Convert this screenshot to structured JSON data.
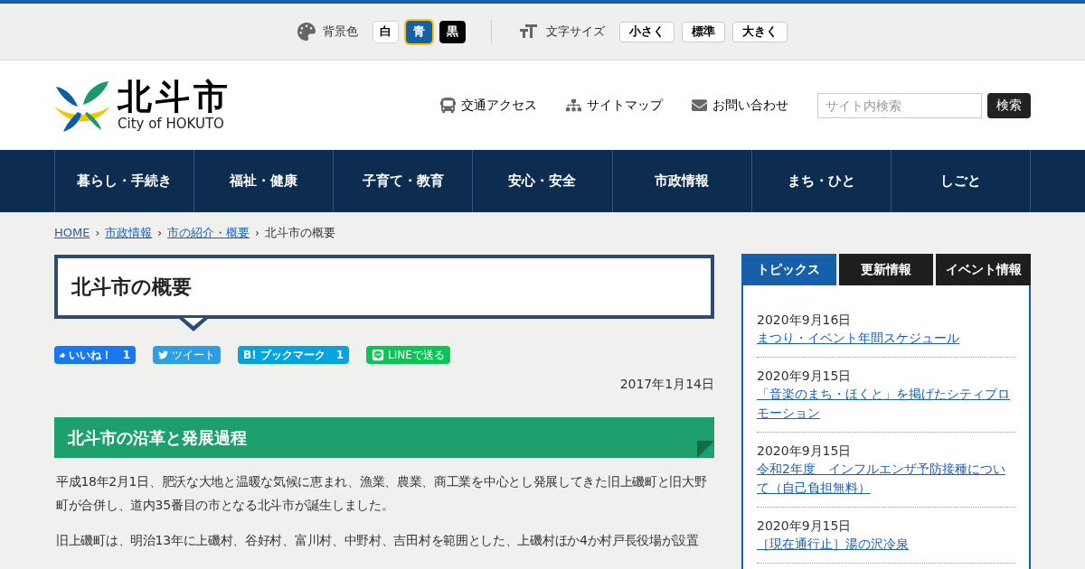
{
  "accessibility_bar": {
    "background": {
      "label": "背景色",
      "options": [
        {
          "label": "白",
          "kind": "white",
          "selected": false
        },
        {
          "label": "青",
          "kind": "blue",
          "selected": true
        },
        {
          "label": "黒",
          "kind": "black",
          "selected": false
        }
      ]
    },
    "text_size": {
      "label": "文字サイズ",
      "options": [
        {
          "label": "小さく",
          "selected": false
        },
        {
          "label": "標準",
          "selected": false
        },
        {
          "label": "大きく",
          "selected": false
        }
      ]
    }
  },
  "header": {
    "logo": {
      "name": "北斗市",
      "subtitle": "City of HOKUTO"
    },
    "links": [
      {
        "label": "交通アクセス",
        "kind": "bus"
      },
      {
        "label": "サイトマップ",
        "kind": "sitemap"
      },
      {
        "label": "お問い合わせ",
        "kind": "mail"
      }
    ],
    "search": {
      "placeholder": "サイト内検索",
      "button": "検索"
    }
  },
  "nav": [
    "暮らし・手続き",
    "福祉・健康",
    "子育て・教育",
    "安心・安全",
    "市政情報",
    "まち・ひと",
    "しごと"
  ],
  "breadcrumb": [
    {
      "label": "HOME",
      "link": true
    },
    {
      "separator": "›",
      "label": "市政情報",
      "link": true
    },
    {
      "separator": "›",
      "label": "市の紹介・概要",
      "link": true
    },
    {
      "separator": "›",
      "label": "北斗市の概要",
      "link": false
    }
  ],
  "page_title": "北斗市の概要",
  "share_buttons": [
    {
      "kind": "like",
      "label": "いいね！",
      "count": "1"
    },
    {
      "kind": "tweet",
      "label": "ツイート"
    },
    {
      "kind": "bookmark",
      "icon_text": "B!",
      "label": "ブックマーク",
      "count": "1"
    },
    {
      "kind": "line",
      "label": "LINEで送る"
    }
  ],
  "date": "2017年1月14日",
  "section_heading": "北斗市の沿革と発展過程",
  "paragraphs": [
    "平成18年2月1日、肥沃な大地と温暖な気候に恵まれ、漁業、農業、商工業を中心とし発展してきた旧上磯町と旧大野町が合併し、道内35番目の市となる北斗市が誕生しました。",
    "旧上磯町は、明治13年に上磯村、谷好村、富川村、中野村、吉田村を範囲とした、上磯村ほか4か村戸長役場が設置"
  ],
  "sidebar": {
    "tabs": [
      {
        "label": "トピックス",
        "selected": true
      },
      {
        "label": "更新情報",
        "selected": false
      },
      {
        "label": "イベント情報",
        "selected": false
      }
    ],
    "items": [
      {
        "date": "2020年9月16日",
        "title": "まつり・イベント年間スケジュール"
      },
      {
        "date": "2020年9月15日",
        "title": "「音楽のまち・ほくと」を掲げたシティプロモーション"
      },
      {
        "date": "2020年9月15日",
        "title": "令和2年度　インフルエンザ予防接種について（自己負担無料）"
      },
      {
        "date": "2020年9月15日",
        "title": "［現在通行止］湯の沢冷泉"
      }
    ]
  }
}
